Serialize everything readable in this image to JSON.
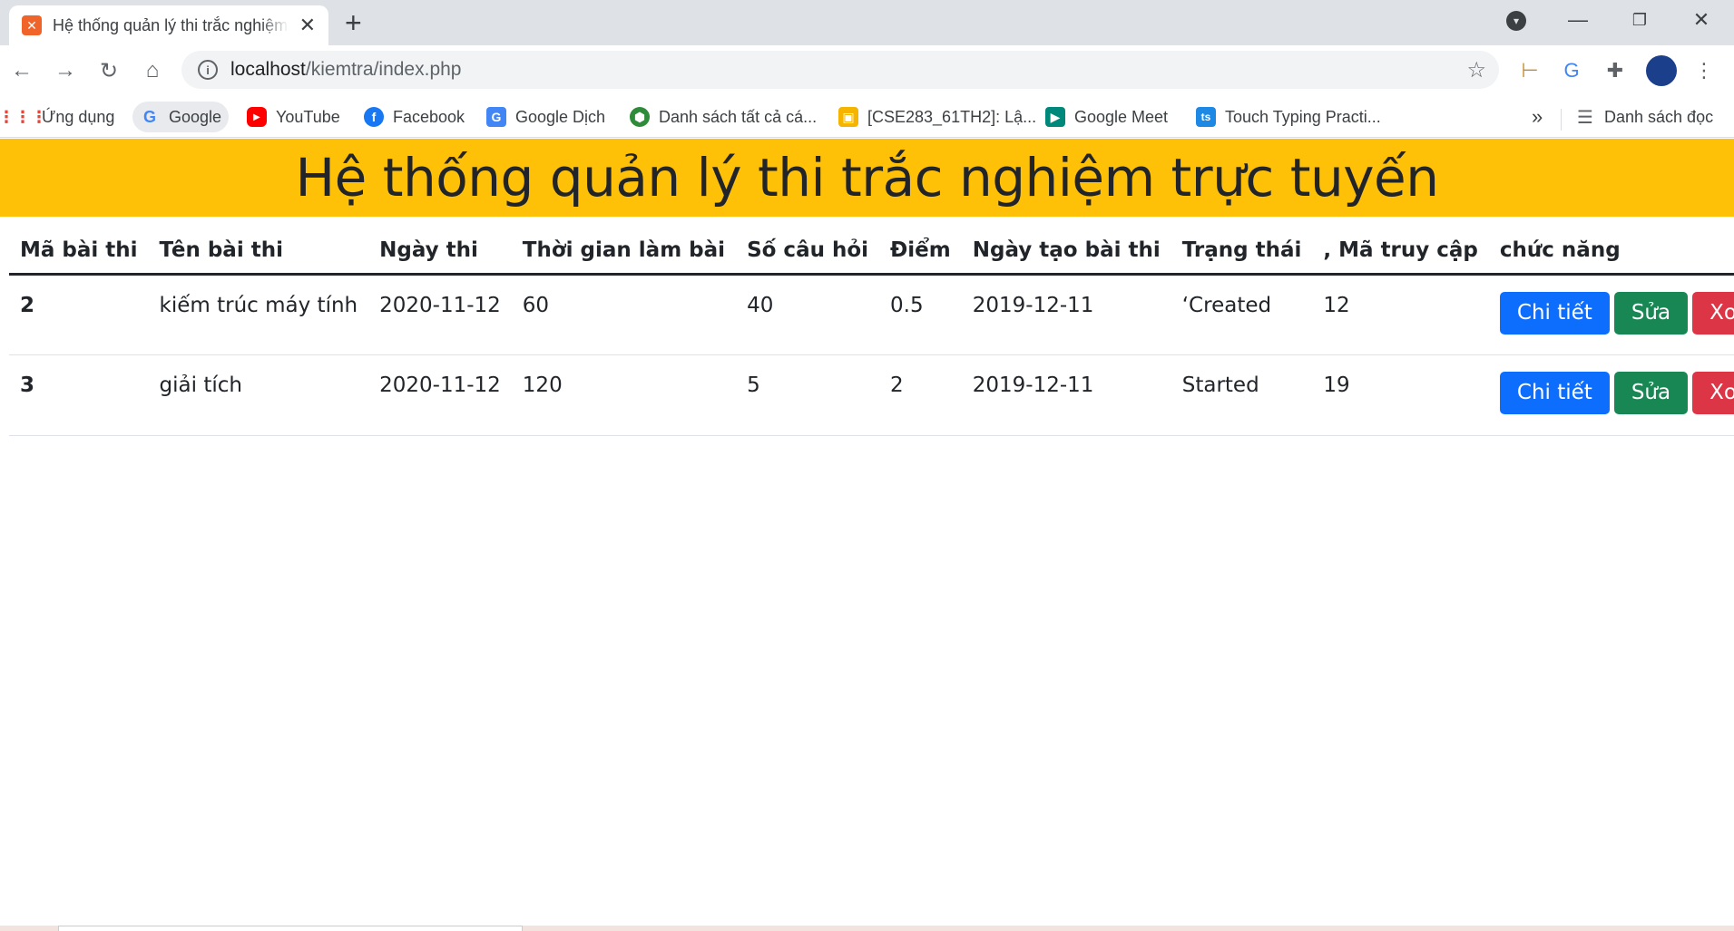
{
  "browser": {
    "tab_title": "Hệ thống quản lý thi trắc nghiệm trực tuyến",
    "favicon_label": "⌘",
    "url_host": "localhost",
    "url_path": "/kiemtra/index.php",
    "bookmarks": [
      {
        "label": "Ứng dụng",
        "icon": "apps-grid-icon"
      },
      {
        "label": "Google",
        "icon": "google-icon"
      },
      {
        "label": "YouTube",
        "icon": "youtube-icon"
      },
      {
        "label": "Facebook",
        "icon": "facebook-icon"
      },
      {
        "label": "Google Dịch",
        "icon": "google-translate-icon"
      },
      {
        "label": "Danh sách tất cả cá...",
        "icon": "green-ball-icon"
      },
      {
        "label": "[CSE283_61TH2]: Lậ...",
        "icon": "classroom-icon"
      },
      {
        "label": "Google Meet",
        "icon": "google-meet-icon"
      },
      {
        "label": "Touch Typing Practi...",
        "icon": "typing-ts-icon"
      }
    ],
    "reading_list": "Danh sách đọc",
    "more": "»"
  },
  "page": {
    "heading": "Hệ thống quản lý thi trắc nghiệm trực tuyến",
    "columns": [
      "Mã bài thi",
      "Tên bài thi",
      "Ngày thi",
      "Thời gian làm bài",
      "Số câu hỏi",
      "Điểm",
      "Ngày tạo bài thi",
      "Trạng thái",
      ", Mã truy cập",
      "chức năng"
    ],
    "rows": [
      {
        "id": "2",
        "name": "kiếm trúc máy tính",
        "date": "2020-11-12",
        "duration": "60",
        "questions": "40",
        "score": "0.5",
        "created": "2019-12-11",
        "status": "‘Created",
        "access_code": "12"
      },
      {
        "id": "3",
        "name": "giải tích",
        "date": "2020-11-12",
        "duration": "120",
        "questions": "5",
        "score": "2",
        "created": "2019-12-11",
        "status": "Started",
        "access_code": "19"
      }
    ],
    "actions": {
      "detail": "Chi tiết",
      "edit": "Sửa",
      "delete": "Xoá"
    }
  },
  "colors": {
    "banner": "#ffc107",
    "primary": "#0d6efd",
    "success": "#198754",
    "danger": "#dc3545"
  }
}
